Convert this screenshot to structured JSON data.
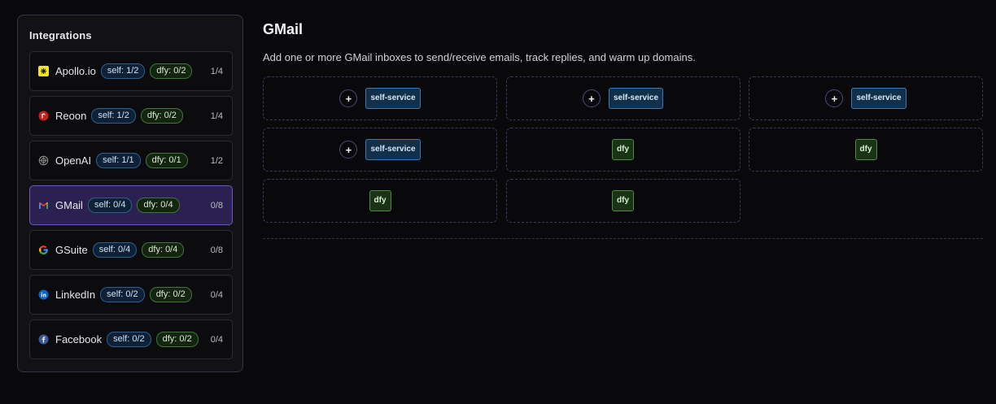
{
  "sidebar": {
    "title": "Integrations",
    "items": [
      {
        "name": "Apollo.io",
        "icon": "apollo-icon",
        "self": "self: 1/2",
        "dfy": "dfy: 0/2",
        "count": "1/4",
        "active": false
      },
      {
        "name": "Reoon",
        "icon": "reoon-icon",
        "self": "self: 1/2",
        "dfy": "dfy: 0/2",
        "count": "1/4",
        "active": false
      },
      {
        "name": "OpenAI",
        "icon": "openai-icon",
        "self": "self: 1/1",
        "dfy": "dfy: 0/1",
        "count": "1/2",
        "active": false
      },
      {
        "name": "GMail",
        "icon": "gmail-icon",
        "self": "self: 0/4",
        "dfy": "dfy: 0/4",
        "count": "0/8",
        "active": true
      },
      {
        "name": "GSuite",
        "icon": "google-icon",
        "self": "self: 0/4",
        "dfy": "dfy: 0/4",
        "count": "0/8",
        "active": false
      },
      {
        "name": "LinkedIn",
        "icon": "linkedin-icon",
        "self": "self: 0/2",
        "dfy": "dfy: 0/2",
        "count": "0/4",
        "active": false
      },
      {
        "name": "Facebook",
        "icon": "facebook-icon",
        "self": "self: 0/2",
        "dfy": "dfy: 0/2",
        "count": "0/4",
        "active": false
      }
    ]
  },
  "main": {
    "title": "GMail",
    "description": "Add one or more GMail inboxes to send/receive emails, track replies, and warm up domains.",
    "add_symbol": "+",
    "slots": [
      {
        "type": "self",
        "label": "self-service",
        "addable": true
      },
      {
        "type": "self",
        "label": "self-service",
        "addable": true
      },
      {
        "type": "self",
        "label": "self-service",
        "addable": true
      },
      {
        "type": "self",
        "label": "self-service",
        "addable": true
      },
      {
        "type": "dfy",
        "label": "dfy",
        "addable": false
      },
      {
        "type": "dfy",
        "label": "dfy",
        "addable": false
      },
      {
        "type": "dfy",
        "label": "dfy",
        "addable": false
      },
      {
        "type": "dfy",
        "label": "dfy",
        "addable": false
      }
    ]
  },
  "colors": {
    "background": "#09090b",
    "active_item_bg": "#2a2150",
    "active_item_border": "#6f56c6",
    "self_chip": "#2b5f8f",
    "dfy_chip": "#3f7440"
  }
}
